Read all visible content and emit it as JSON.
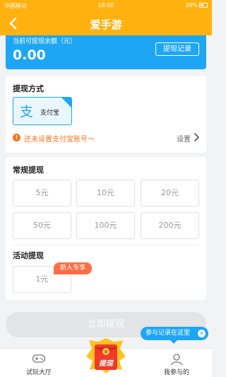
{
  "statusbar": {
    "carrier": "中国移动",
    "time": "18:00",
    "battery": "39%"
  },
  "nav": {
    "title": "爱手游"
  },
  "balance": {
    "label": "当前可提现余额（元）",
    "value": "0.00",
    "record_button": "提现记录"
  },
  "method": {
    "title": "提现方式",
    "option": "支付宝",
    "warning": "还未设置支付宝账号～",
    "setup": "设置"
  },
  "regular": {
    "title": "常规提现",
    "amounts": [
      "5元",
      "10元",
      "20元",
      "50元",
      "100元",
      "200元"
    ]
  },
  "activity": {
    "title": "活动提现",
    "amount": "1元",
    "badge": "新人专享"
  },
  "submit": {
    "label": "立即提现"
  },
  "tip": {
    "text": "参与记录在这里"
  },
  "tabbar": {
    "left": "试玩大厅",
    "center": "提现",
    "right": "我参与的"
  },
  "colors": {
    "brand": "#ffb20f",
    "accent": "#1ea6f5",
    "warning": "#f5741e",
    "badge": "#ff6e45"
  }
}
